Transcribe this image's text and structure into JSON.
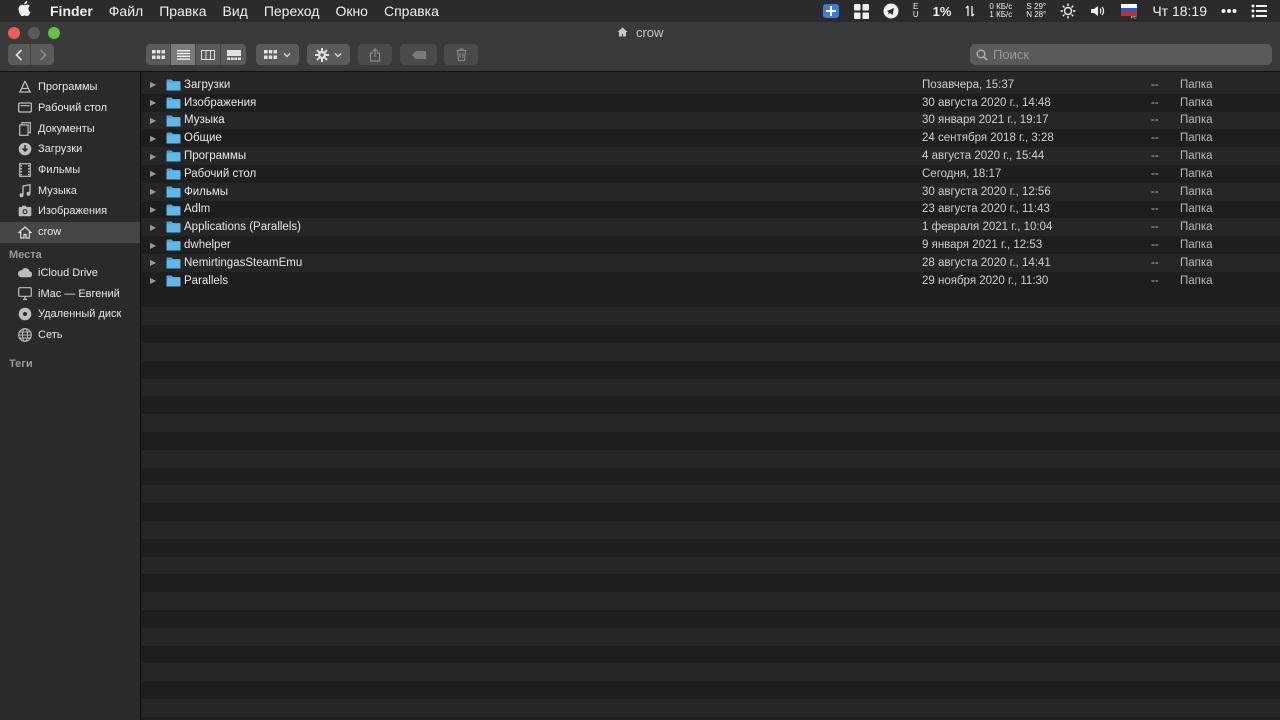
{
  "menubar": {
    "app_name": "Finder",
    "items": [
      "Файл",
      "Правка",
      "Вид",
      "Переход",
      "Окно",
      "Справка"
    ],
    "cpu_percent": "1%",
    "net_down": "0 КБ/с",
    "net_up": "1 КБ/с",
    "temp_1_label": "S",
    "temp_1": "29°",
    "temp_2_label": "N",
    "temp_2": "28°",
    "clock": "Чт 18:19",
    "lang_flag": "PC"
  },
  "window": {
    "title": "crow"
  },
  "search": {
    "placeholder": "Поиск"
  },
  "sidebar": {
    "favorites": [
      {
        "label": "Программы",
        "icon": "applications-icon"
      },
      {
        "label": "Рабочий стол",
        "icon": "desktop-icon"
      },
      {
        "label": "Документы",
        "icon": "documents-icon"
      },
      {
        "label": "Загрузки",
        "icon": "downloads-icon"
      },
      {
        "label": "Фильмы",
        "icon": "movies-icon"
      },
      {
        "label": "Музыка",
        "icon": "music-icon"
      },
      {
        "label": "Изображения",
        "icon": "pictures-icon"
      },
      {
        "label": "crow",
        "icon": "home-icon",
        "selected": true
      }
    ],
    "places_header": "Места",
    "places": [
      {
        "label": "iCloud Drive",
        "icon": "cloud-icon"
      },
      {
        "label": "iMac — Евгений",
        "icon": "imac-icon"
      },
      {
        "label": "Удаленный диск",
        "icon": "disc-icon"
      },
      {
        "label": "Сеть",
        "icon": "network-icon"
      }
    ],
    "tags_header": "Теги"
  },
  "files": [
    {
      "name": "Загрузки",
      "date": "Позавчера, 15:37",
      "size": "--",
      "kind": "Папка"
    },
    {
      "name": "Изображения",
      "date": "30 августа 2020 г., 14:48",
      "size": "--",
      "kind": "Папка"
    },
    {
      "name": "Музыка",
      "date": "30 января 2021 г., 19:17",
      "size": "--",
      "kind": "Папка"
    },
    {
      "name": "Общие",
      "date": "24 сентября 2018 г., 3:28",
      "size": "--",
      "kind": "Папка"
    },
    {
      "name": "Программы",
      "date": "4 августа 2020 г., 15:44",
      "size": "--",
      "kind": "Папка"
    },
    {
      "name": "Рабочий стол",
      "date": "Сегодня, 18:17",
      "size": "--",
      "kind": "Папка"
    },
    {
      "name": "Фильмы",
      "date": "30 августа 2020 г., 12:56",
      "size": "--",
      "kind": "Папка"
    },
    {
      "name": "Adlm",
      "date": "23 августа 2020 г., 11:43",
      "size": "--",
      "kind": "Папка"
    },
    {
      "name": "Applications (Parallels)",
      "date": "1 февраля 2021 г., 10:04",
      "size": "--",
      "kind": "Папка"
    },
    {
      "name": "dwhelper",
      "date": "9 января 2021 г., 12:53",
      "size": "--",
      "kind": "Папка"
    },
    {
      "name": "NemirtingasSteamEmu",
      "date": "28 августа 2020 г., 14:41",
      "size": "--",
      "kind": "Папка"
    },
    {
      "name": "Parallels",
      "date": "29 ноября 2020 г., 11:30",
      "size": "--",
      "kind": "Папка"
    }
  ],
  "colors": {
    "folder_blue": "#4aa8e0",
    "close": "#ec5f59",
    "zoom": "#5fc53f"
  }
}
